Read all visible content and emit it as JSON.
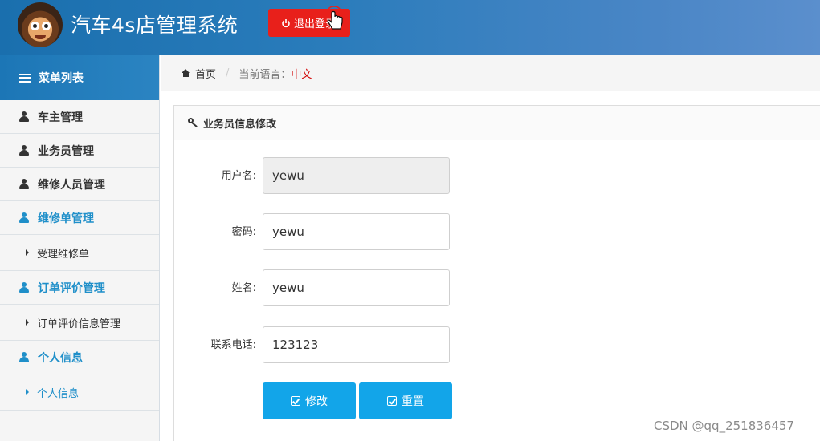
{
  "header": {
    "app_title": "汽车4s店管理系统",
    "logout_label": "退出登录",
    "avatar_icon": "cartoon-avatar"
  },
  "sidebar": {
    "title": "菜单列表",
    "items": [
      {
        "label": "车主管理",
        "icon": "user-icon"
      },
      {
        "label": "业务员管理",
        "icon": "user-icon"
      },
      {
        "label": "维修人员管理",
        "icon": "user-icon"
      },
      {
        "label": "维修单管理",
        "icon": "user-icon",
        "active": true
      },
      {
        "label": "受理维修单",
        "icon": "caret-right-icon",
        "sub": true
      },
      {
        "label": "订单评价管理",
        "icon": "user-icon",
        "active": true
      },
      {
        "label": "订单评价信息管理",
        "icon": "caret-right-icon",
        "sub": true
      },
      {
        "label": "个人信息",
        "icon": "user-icon",
        "active": true
      },
      {
        "label": "个人信息",
        "icon": "caret-right-icon",
        "sub": true,
        "active": true
      }
    ]
  },
  "breadcrumb": {
    "home": "首页",
    "current_language_label": "当前语言：",
    "current_language": "中文"
  },
  "form": {
    "title": "业务员信息修改",
    "fields": [
      {
        "label": "用户名:",
        "value": "yewu",
        "readonly": true
      },
      {
        "label": "密码:",
        "value": "yewu"
      },
      {
        "label": "姓名:",
        "value": "yewu"
      },
      {
        "label": "联系电话:",
        "value": "123123"
      }
    ],
    "submit_label": "修改",
    "reset_label": "重置"
  },
  "watermark": "CSDN @qq_251836457",
  "colors": {
    "header_blue": "#1a6fae",
    "accent": "#1f8fc9",
    "button": "#12a5e9",
    "logout_red": "#e8201b",
    "language_red": "#d20000"
  }
}
